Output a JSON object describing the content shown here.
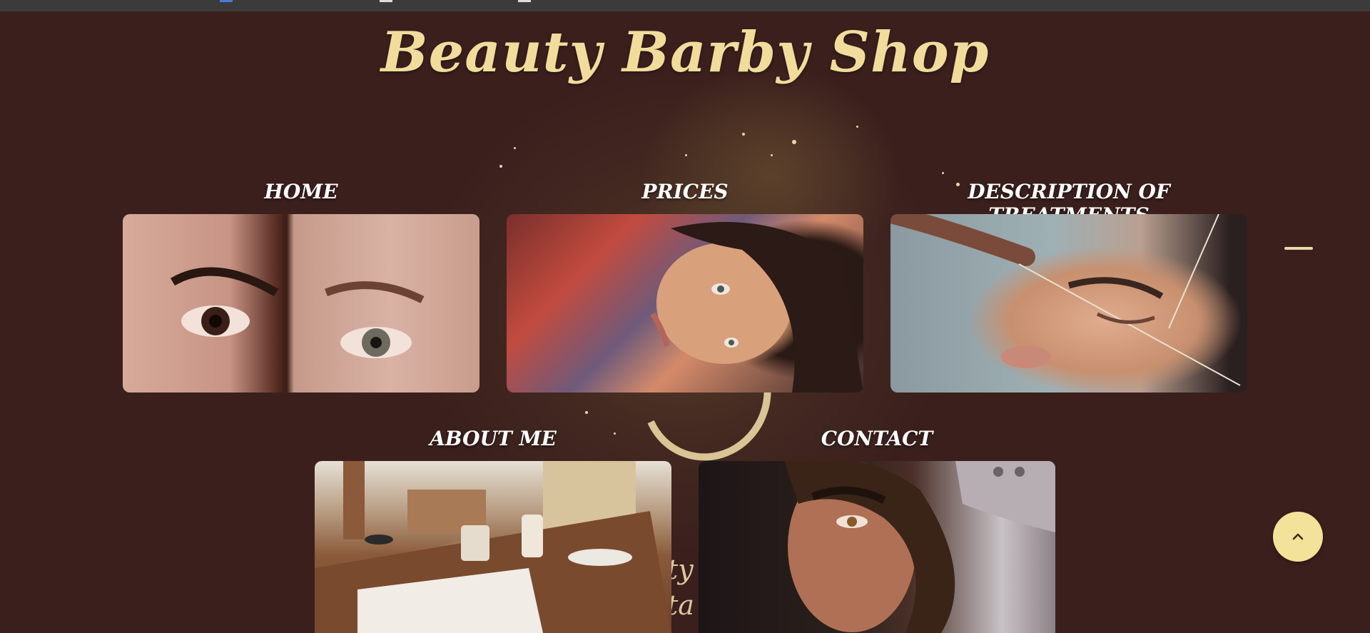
{
  "site": {
    "logo_text": "Beauty Barby Shop"
  },
  "cards": [
    {
      "title": "HOME",
      "image": "eyes-closeup-photo"
    },
    {
      "title": "PRICES",
      "image": "woman-portrait-photo"
    },
    {
      "title": "DESCRIPTION OF TREATMENTS",
      "image": "eyebrow-threading-photo"
    },
    {
      "title": "ABOUT ME",
      "image": "cafe-table-photo"
    },
    {
      "title": "CONTACT",
      "image": "woman-eyebrow-photo"
    }
  ],
  "scroll_top": {
    "icon": "chevron-up-icon"
  },
  "colors": {
    "background": "#3a1f1d",
    "logo": "#f2dc9c",
    "accent_button": "#f2e29a",
    "card_title": "#ffffff"
  }
}
